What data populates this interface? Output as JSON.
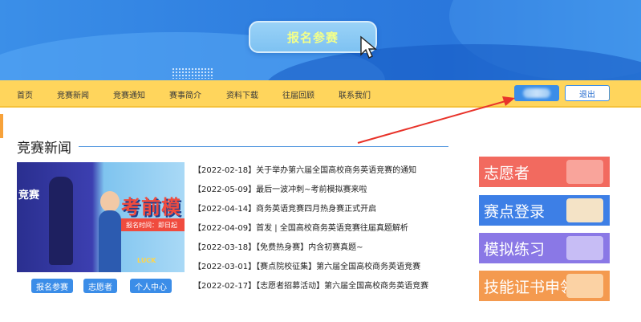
{
  "banner": {
    "signup_label": "报名参赛"
  },
  "nav": {
    "items": [
      "首页",
      "竞赛新闻",
      "竞赛通知",
      "赛事简介",
      "资料下载",
      "往届回顾",
      "联系我们"
    ],
    "logout_label": "退出"
  },
  "section": {
    "title": "竞赛新闻"
  },
  "promo": {
    "left_text": "竞赛",
    "headline": "考前模",
    "tag": "报名时间：即日起",
    "luck": "LUCK",
    "buttons": [
      "报名参赛",
      "志愿者",
      "个人中心"
    ]
  },
  "news": [
    "【2022-02-18】关于举办第六届全国高校商务英语竞赛的通知",
    "【2022-05-09】最后一波冲刺~考前模拟赛来啦",
    "【2022-04-14】商务英语竞赛四月热身赛正式开启",
    "【2022-04-09】首发 | 全国高校商务英语竞赛往届真题解析",
    "【2022-03-18】【免费热身赛】内含初赛真题~",
    "【2022-03-01】【赛点院校征集】第六届全国高校商务英语竞赛",
    "【2022-02-17】【志愿者招募活动】第六届全国高校商务英语竞赛"
  ],
  "tiles": [
    {
      "label": "志愿者",
      "color": "#f26a5f"
    },
    {
      "label": "赛点登录",
      "color": "#3d7fe6"
    },
    {
      "label": "模拟练习",
      "color": "#8a78e6"
    },
    {
      "label": "技能证书申领",
      "color": "#f49a4f"
    }
  ],
  "colors": {
    "nav_bg": "#ffd55c",
    "banner_blue": "#2f7fe0",
    "button_blue": "#3b8de8",
    "arrow_red": "#e8332a"
  }
}
